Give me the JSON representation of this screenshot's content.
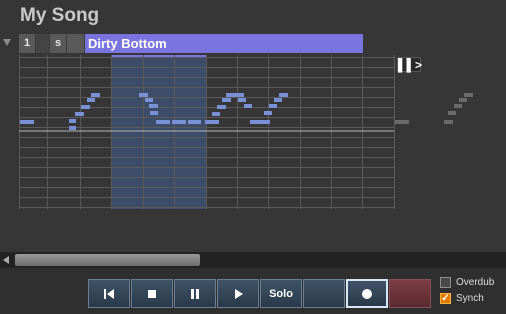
{
  "song_title": "My Song",
  "track": {
    "number": "1",
    "solo_short": "s",
    "name": "Dirty Bottom",
    "color": "#7a74de"
  },
  "panel_expand_label": "▌▌>",
  "transport": {
    "rewind_icon": "skip-back-icon",
    "stop_icon": "stop-icon",
    "pause_icon": "pause-icon",
    "play_icon": "play-icon",
    "solo_label": "Solo",
    "record_icon": "record-icon"
  },
  "options": {
    "overdub_label": "Overdub",
    "overdub_checked": false,
    "synch_label": "Synch",
    "synch_checked": true
  },
  "colors": {
    "note": "#7a90d6",
    "selection": "#3a4a6a",
    "ghost_note": "#6a6a6a",
    "record_accent": "#7b3d43"
  }
}
